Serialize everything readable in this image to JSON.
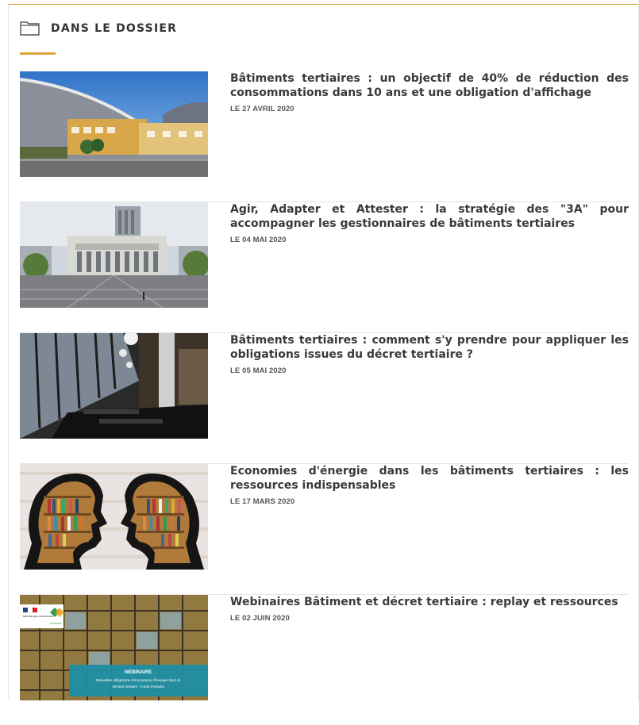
{
  "section": {
    "title": "DANS LE DOSSIER",
    "icon": "folder-icon",
    "accent_color": "#e0a23a"
  },
  "articles": [
    {
      "title": "Bâtiments tertiaires : un objectif de 40% de réduction des consommations dans 10 ans et une obligation d'affichage",
      "date": "LE 27 AVRIL 2020"
    },
    {
      "title": "Agir, Adapter et Attester : la stratégie des \"3A\" pour accompagner les gestionnaires de bâtiments tertiaires",
      "date": "LE 04 MAI 2020"
    },
    {
      "title": "Bâtiments tertiaires : comment s'y prendre pour appliquer les obligations issues du décret tertiaire ?",
      "date": "LE 05 MAI 2020"
    },
    {
      "title": "Economies d'énergie dans les bâtiments tertiaires : les ressources indispensables",
      "date": "LE 17 MARS 2020"
    },
    {
      "title": "Webinaires Bâtiment et décret tertiaire : replay et ressources",
      "date": "LE 02 JUIN 2020",
      "thumb_text": {
        "heading": "WEBINAIRE",
        "line1": "Nouvelles obligations d'économies d'énergie dans le",
        "line2": "secteur tertiaire : mode d'emploi",
        "logo_left": "RÉPUBLIQUE FRANÇAISE",
        "logo_right": "Cerema"
      }
    }
  ]
}
